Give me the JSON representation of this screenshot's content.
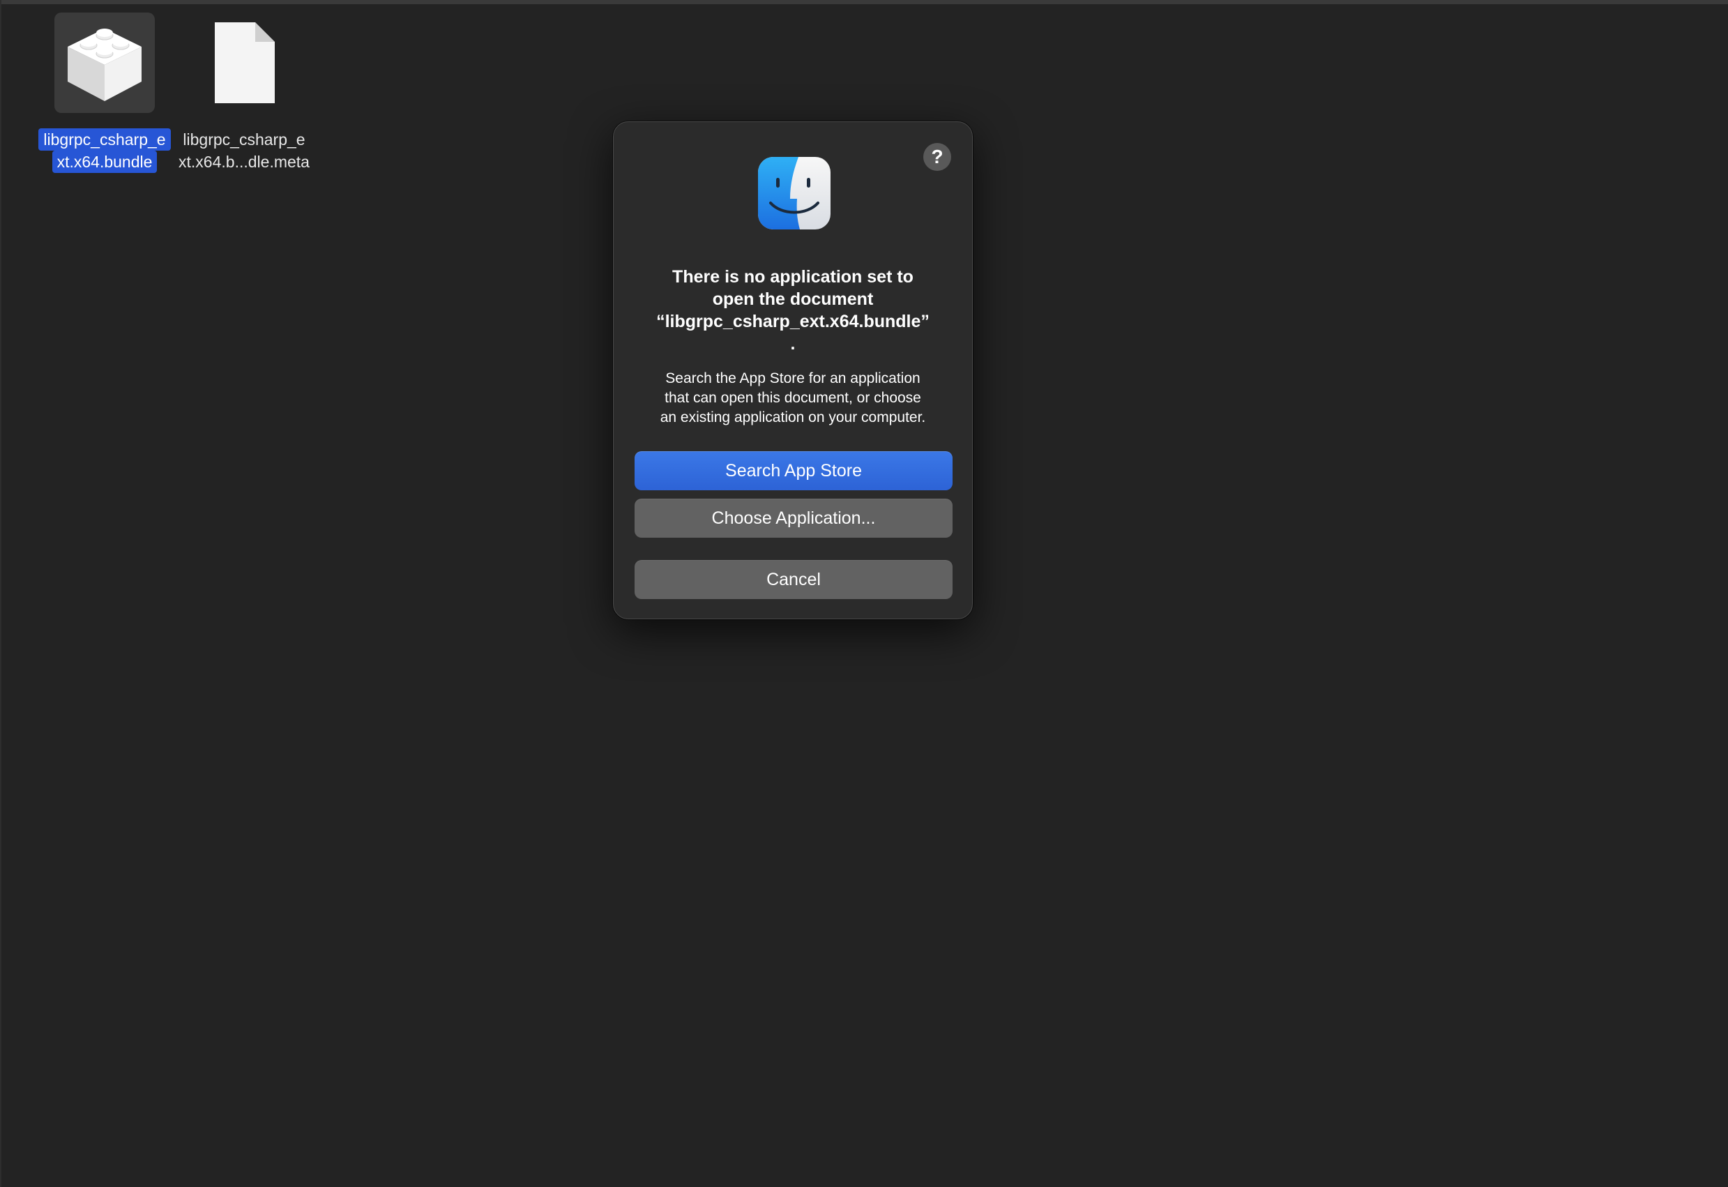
{
  "desktop": {
    "items": [
      {
        "name_line1": "libgrpc_csharp_e",
        "name_line2": "xt.x64.bundle",
        "selected": true,
        "icon": "lego-brick-bundle-icon"
      },
      {
        "name_line1": "libgrpc_csharp_e",
        "name_line2": "xt.x64.b...dle.meta",
        "selected": false,
        "icon": "blank-document-icon"
      }
    ]
  },
  "dialog": {
    "icon": "finder-icon",
    "help_label": "?",
    "title": "There is no application set to\nopen the document\n“libgrpc_csharp_ext.x64.bundle”\n.",
    "message": "Search the App Store for an application\nthat can open this document, or choose\nan existing application on your computer.",
    "buttons": {
      "search_app_store": "Search App Store",
      "choose_application": "Choose Application...",
      "cancel": "Cancel"
    },
    "colors": {
      "primary": "#2d63d6",
      "secondary": "#626262",
      "selection": "#2756d6"
    }
  }
}
